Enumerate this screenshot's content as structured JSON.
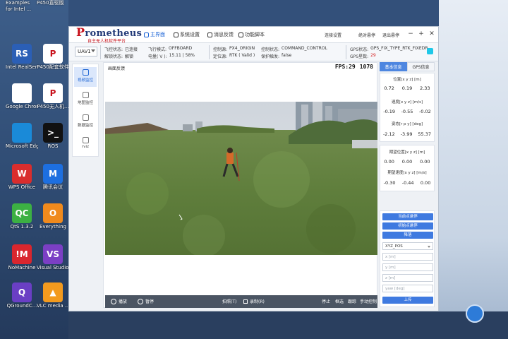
{
  "desktop": {
    "top_labels": [
      "Examples",
      "for Intel ...",
      "P450直驱版"
    ],
    "icons": [
      {
        "label": "Intel RealSen...",
        "glyph": "RS",
        "icon": "realsense-icon",
        "color": "#2b5fb6"
      },
      {
        "label": "P450配套软件",
        "glyph": "P",
        "icon": "prometheus-icon",
        "color": "#ffffff"
      },
      {
        "label": "Google Chrome",
        "glyph": "",
        "icon": "chrome-icon",
        "color": "#ffffff"
      },
      {
        "label": "P450无人机...",
        "glyph": "P",
        "icon": "prometheus-icon",
        "color": "#ffffff"
      },
      {
        "label": "Microsoft Edge",
        "glyph": "",
        "icon": "edge-icon",
        "color": "#1a8ad8"
      },
      {
        "label": "ROS",
        "glyph": ">_",
        "icon": "terminal-icon",
        "color": "#111111"
      },
      {
        "label": "WPS Office",
        "glyph": "W",
        "icon": "wps-icon",
        "color": "#d92d2d"
      },
      {
        "label": "腾讯会议",
        "glyph": "M",
        "icon": "meeting-icon",
        "color": "#1d6fe0"
      },
      {
        "label": "QtS 1.3.2",
        "glyph": "QC",
        "icon": "qt-icon",
        "color": "#3cb043"
      },
      {
        "label": "Everything",
        "glyph": "O",
        "icon": "everything-icon",
        "color": "#f08a1d"
      },
      {
        "label": "NoMachine",
        "glyph": "!M",
        "icon": "nomachine-icon",
        "color": "#d9262e"
      },
      {
        "label": "Visual Studio 2019",
        "glyph": "VS",
        "icon": "visual-studio-icon",
        "color": "#7b3fc4"
      },
      {
        "label": "QGroundC...",
        "glyph": "Q",
        "icon": "qgroundcontrol-icon",
        "color": "#6a3fc4"
      },
      {
        "label": "VLC media ...",
        "glyph": "▲",
        "icon": "vlc-icon",
        "color": "#f39a1e"
      }
    ]
  },
  "app": {
    "logo_main": "rometheus",
    "logo_p": "P",
    "logo_sub": "自主无人机软件平台",
    "tabs": [
      {
        "label": "主界面",
        "icon": "home-icon"
      },
      {
        "label": "系统设置",
        "icon": "settings-icon"
      },
      {
        "label": "消息反馈",
        "icon": "message-icon"
      },
      {
        "label": "功能脚本",
        "icon": "script-icon"
      }
    ],
    "actions": [
      {
        "label": "连接设置",
        "icon": "link-icon"
      },
      {
        "label": "绝对悬停",
        "icon": "hover-icon"
      },
      {
        "label": "退出悬停",
        "icon": "exit-icon"
      }
    ],
    "window_buttons": [
      "−",
      "+",
      "✕"
    ]
  },
  "status": {
    "uav": "UAV1",
    "arm_state_label": "飞控状态:",
    "arm_state_value": "已连接",
    "lock_label": "解锁状态:",
    "lock_value": "解锁",
    "mode_label": "飞行模式:",
    "mode_value": "OFFBOARD",
    "battery_label": "电量( V ):",
    "battery_value": "15.11 | 58%",
    "ctrl_label": "控制源:",
    "ctrl_value": "PX4_ORIGIN",
    "pos_label": "定位源:",
    "pos_value": "RTK ( Valid )",
    "cmd_label": "控制状态:",
    "cmd_value": "COMMAND_CONTROL",
    "protect_label": "保护触发:",
    "protect_value": "false",
    "gps_state_label": "GPS状态:",
    "gps_state_value": "GPS_FIX_TYPE_RTK_FIXEDR",
    "gps_sat_label": "GPS星数:",
    "gps_sat_value": "29"
  },
  "nav": [
    {
      "label": "视频监控",
      "icon": "camera-icon"
    },
    {
      "label": "地图监控",
      "icon": "map-icon"
    },
    {
      "label": "数据监控",
      "icon": "data-icon"
    },
    {
      "label": "rviz",
      "icon": "rviz-icon"
    }
  ],
  "video": {
    "title": "画面反馈",
    "fps_label": "FPS:",
    "fps_value": "29",
    "frame_count": "1078",
    "controls": {
      "play": "播放",
      "pause": "暂停",
      "capture": "拍照(T)",
      "record": "录制(R)",
      "stop": "停止",
      "track": "框选",
      "follow": "跟踪",
      "manual": "手动控制"
    }
  },
  "right": {
    "tabs": [
      "基本信息",
      "GPS信息"
    ],
    "position_label": "位置[x y z] [m]",
    "position": [
      "0.72",
      "0.19",
      "2.33"
    ],
    "velocity_label": "速度[x y z] [m/s]",
    "velocity": [
      "-0.19",
      "-0.55",
      "-0.02"
    ],
    "attitude_label": "姿态[r p y] [deg]",
    "attitude": [
      "-2.12",
      "-3.99",
      "55.37"
    ],
    "target_pos_label": "期望位置[x y z] [m]",
    "target_pos": [
      "0.00",
      "0.00",
      "0.00"
    ],
    "target_vel_label": "期望速度[x y z] [m/s]",
    "target_vel": [
      "-0.30",
      "-0.44",
      "0.00"
    ],
    "buttons": [
      "当前点悬停",
      "初始点悬停",
      "降落"
    ],
    "mode_select": "XYZ_POS",
    "inputs": [
      "x [m]",
      "y [m]",
      "z [m]",
      "yaw [deg]"
    ],
    "submit": "上传"
  }
}
